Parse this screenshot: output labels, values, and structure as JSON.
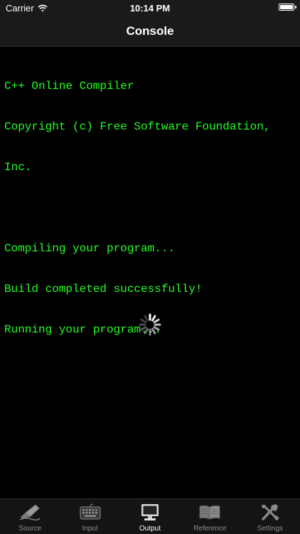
{
  "status_bar": {
    "carrier": "Carrier",
    "time": "10:14 PM"
  },
  "nav": {
    "title": "Console"
  },
  "console": {
    "lines": [
      "C++ Online Compiler",
      "Copyright (c) Free Software Foundation,",
      "Inc.",
      "",
      "Compiling your program...",
      "Build completed successfully!",
      "Running your program..."
    ],
    "text_color": "#22ff22"
  },
  "tabs": [
    {
      "label": "Source",
      "icon": "pen-icon",
      "active": false
    },
    {
      "label": "Input",
      "icon": "keyboard-icon",
      "active": false
    },
    {
      "label": "Output",
      "icon": "monitor-icon",
      "active": true
    },
    {
      "label": "Reference",
      "icon": "book-icon",
      "active": false
    },
    {
      "label": "Settings",
      "icon": "tools-icon",
      "active": false
    }
  ]
}
